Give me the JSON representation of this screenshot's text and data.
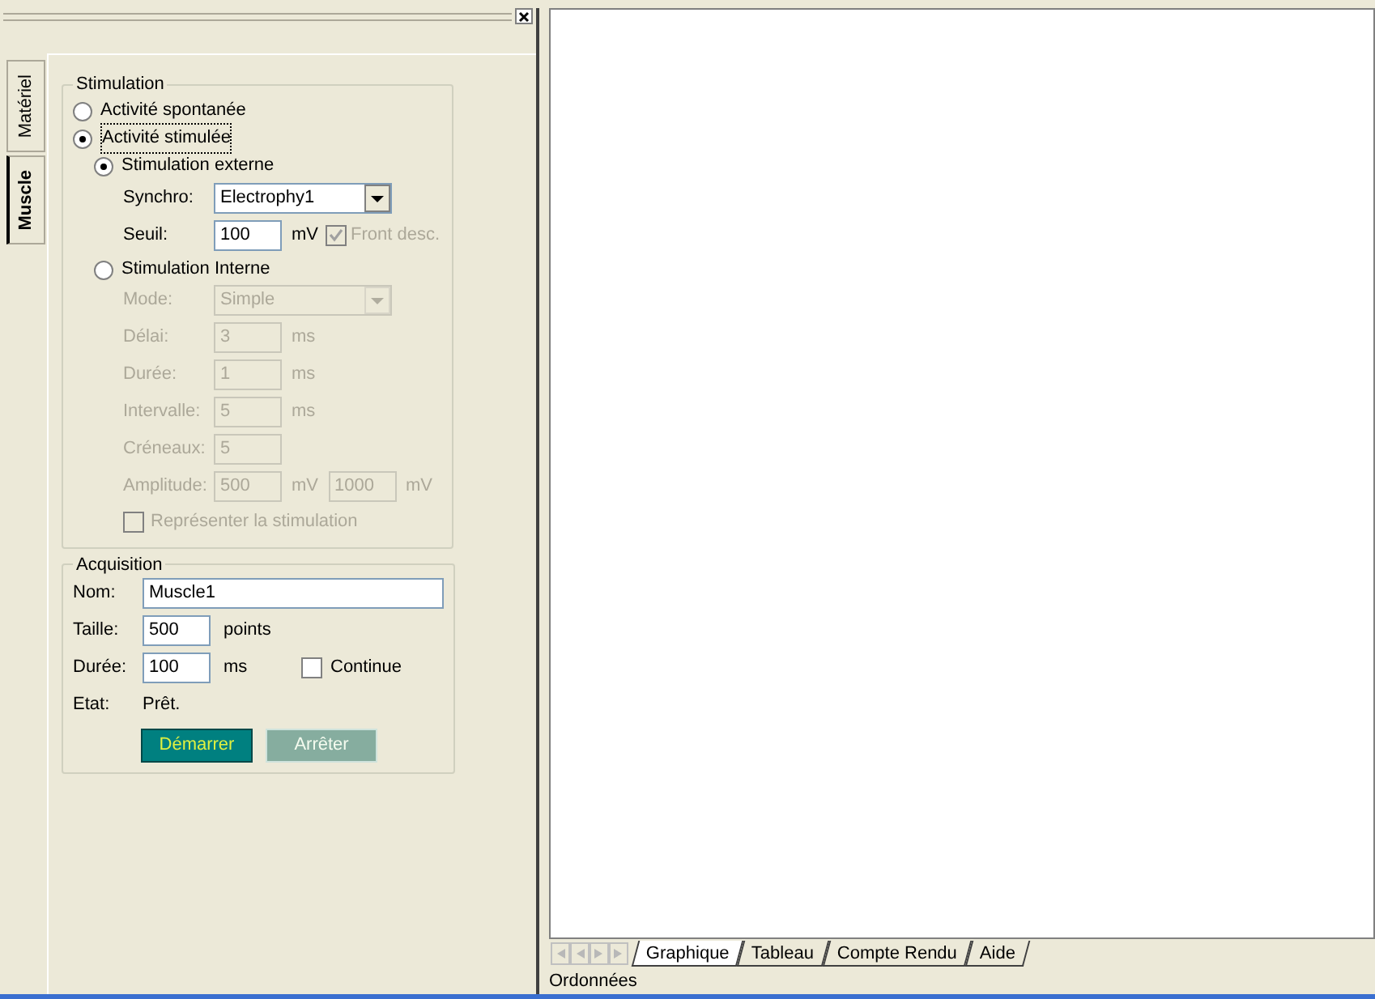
{
  "side_tabs": [
    {
      "label": "Matériel",
      "selected": false
    },
    {
      "label": "Muscle",
      "selected": true
    }
  ],
  "stimulation": {
    "title": "Stimulation",
    "modes": [
      {
        "label": "Activité spontanée",
        "selected": false
      },
      {
        "label": "Activité stimulée",
        "selected": true
      }
    ],
    "external": {
      "label": "Stimulation externe",
      "selected": true,
      "synchro": {
        "label": "Synchro:",
        "value": "Electrophy1"
      },
      "seuil": {
        "label": "Seuil:",
        "value": "100",
        "unit": "mV"
      },
      "front_desc": {
        "label": "Front desc.",
        "checked": true,
        "disabled": true
      }
    },
    "internal": {
      "label": "Stimulation Interne",
      "selected": false,
      "disabled": true,
      "rows": [
        {
          "kind": "select",
          "label": "Mode:",
          "value": "Simple"
        },
        {
          "kind": "input",
          "label": "Délai:",
          "inputs": [
            {
              "value": "3",
              "unit": "ms"
            }
          ]
        },
        {
          "kind": "input",
          "label": "Durée:",
          "inputs": [
            {
              "value": "1",
              "unit": "ms"
            }
          ]
        },
        {
          "kind": "input",
          "label": "Intervalle:",
          "inputs": [
            {
              "value": "5",
              "unit": "ms"
            }
          ]
        },
        {
          "kind": "input",
          "label": "Créneaux:",
          "inputs": [
            {
              "value": "5"
            }
          ]
        },
        {
          "kind": "input",
          "label": "Amplitude:",
          "inputs": [
            {
              "value": "500",
              "unit": "mV"
            },
            {
              "value": "1000",
              "unit": "mV"
            }
          ]
        }
      ],
      "represent": {
        "label": "Représenter la stimulation",
        "checked": false
      }
    }
  },
  "acquisition": {
    "title": "Acquisition",
    "nom": {
      "label": "Nom:",
      "value": "Muscle1"
    },
    "taille": {
      "label": "Taille:",
      "value": "500",
      "unit": "points"
    },
    "duree": {
      "label": "Durée:",
      "value": "100",
      "unit": "ms"
    },
    "continue": {
      "label": "Continue",
      "checked": false
    },
    "etat": {
      "label": "Etat:",
      "value": "Prêt."
    },
    "buttons": [
      {
        "label": "Démarrer",
        "disabled": false
      },
      {
        "label": "Arrêter",
        "disabled": true
      }
    ]
  },
  "sheet_tabs": [
    {
      "label": "Graphique",
      "selected": true
    },
    {
      "label": "Tableau",
      "selected": false
    },
    {
      "label": "Compte Rendu",
      "selected": false
    },
    {
      "label": "Aide",
      "selected": false
    }
  ],
  "status_bar": "Ordonnées"
}
